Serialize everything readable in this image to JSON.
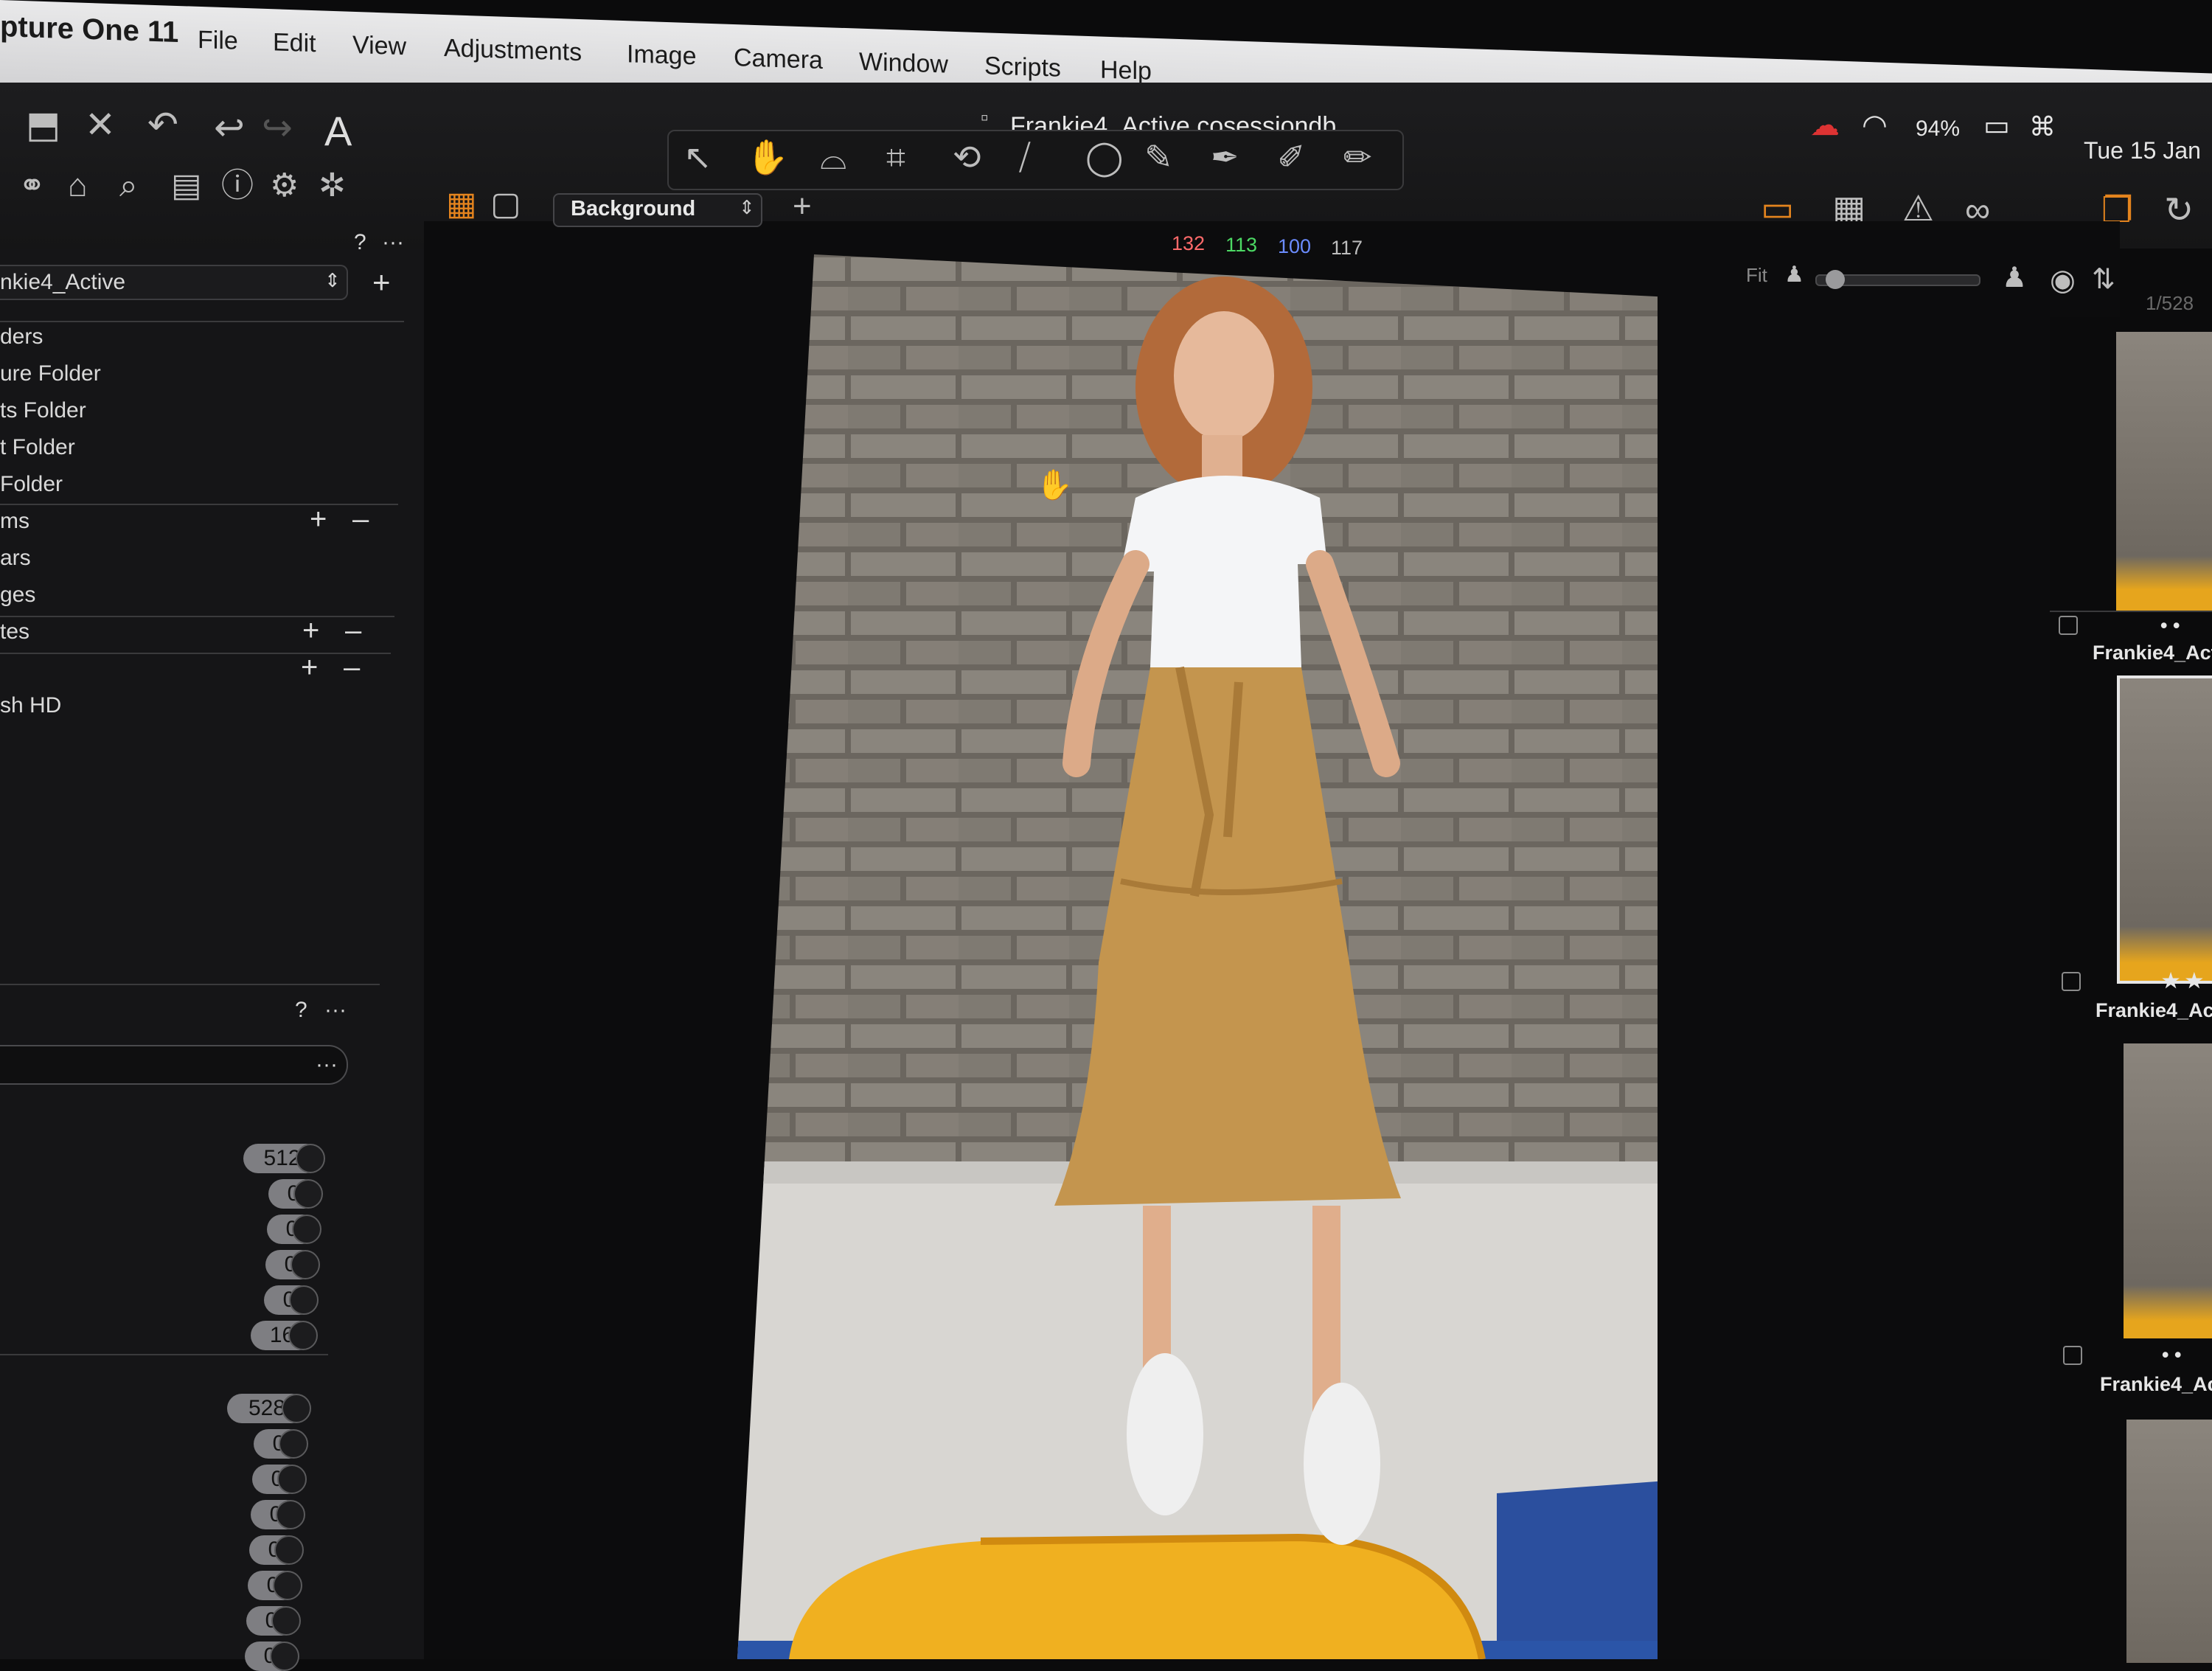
{
  "menubar": {
    "app_name": "pture One 11",
    "menus": [
      "File",
      "Edit",
      "View",
      "Adjustments",
      "Image",
      "Camera",
      "Window",
      "Scripts",
      "Help"
    ],
    "battery": "94%",
    "datetime": "Tue 15 Jan"
  },
  "toolbar": {
    "document_title": "Frankie4_Active.cosessiondb",
    "layer_select": "Background",
    "rgb_readout": {
      "r": "132",
      "g": "113",
      "b": "100",
      "l": "117"
    },
    "fit_label": "Fit",
    "counter": "1/528"
  },
  "left_panel": {
    "help_mark": "?",
    "more_mark": "···",
    "session_select": "nkie4_Active",
    "session_folders": [
      "ders",
      "ure Folder",
      "ts Folder",
      "t Folder",
      "Folder"
    ],
    "groups": [
      "ms",
      "ars",
      "ges",
      "tes",
      "",
      "sh HD",
      ""
    ],
    "plus_mark": "+",
    "minus_mark": "–",
    "filters_help": "?",
    "filters_more": "···",
    "search_more": "···",
    "counts_a": [
      "512",
      "0",
      "0",
      "0",
      "0",
      "16"
    ],
    "counts_b": [
      "528",
      "0",
      "0",
      "0",
      "0",
      "0",
      "0",
      "0"
    ]
  },
  "filmstrip": {
    "labels": [
      "Frankie4_Acti",
      "Frankie4_Act",
      "Frankie4_Ac"
    ],
    "ratings": [
      "• •",
      "★ ★",
      "• •"
    ]
  },
  "colors": {
    "accent": "#e4841e",
    "red_channel": "#ff6a6a",
    "green_channel": "#4cd964",
    "blue_channel": "#6b8cff"
  }
}
